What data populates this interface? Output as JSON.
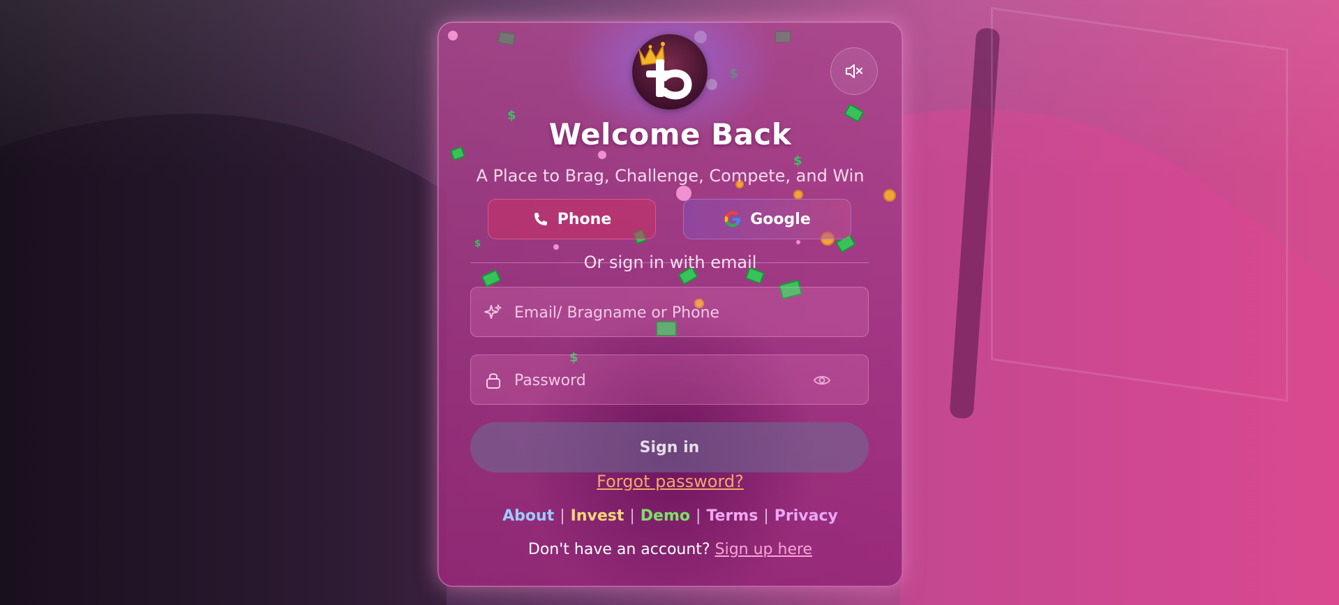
{
  "header": {
    "title": "Welcome Back",
    "subtitle": "A Place to Brag, Challenge, Compete, and Win"
  },
  "brand": {
    "logo_icon": "crowned-b-logo-icon"
  },
  "sound": {
    "icon": "speaker-muted-icon"
  },
  "social": {
    "phone_label": "Phone",
    "phone_icon": "phone-icon",
    "google_label": "Google",
    "google_icon": "google-g-icon"
  },
  "divider": {
    "text": "Or sign in with email"
  },
  "form": {
    "email_placeholder": "Email/ Bragname or Phone",
    "email_icon": "sparkle-icon",
    "password_placeholder": "Password",
    "password_icon": "lock-icon",
    "password_toggle_icon": "eye-icon",
    "submit_label": "Sign in"
  },
  "links": {
    "forgot_password": "Forgot password?",
    "footer": [
      {
        "label": "About",
        "color": "#9ec9ff"
      },
      {
        "label": "Invest",
        "color": "#f7d67a"
      },
      {
        "label": "Demo",
        "color": "#7ee06a"
      },
      {
        "label": "Terms",
        "color": "#f0a8f0"
      },
      {
        "label": "Privacy",
        "color": "#e9a8f5"
      }
    ],
    "signup_prompt": "Don't have an account?",
    "signup_link": "Sign up here"
  },
  "colors": {
    "accent_pink": "#d44c8e",
    "forgot_link": "#f5a76a",
    "signup_link": "#f8a6d6"
  }
}
